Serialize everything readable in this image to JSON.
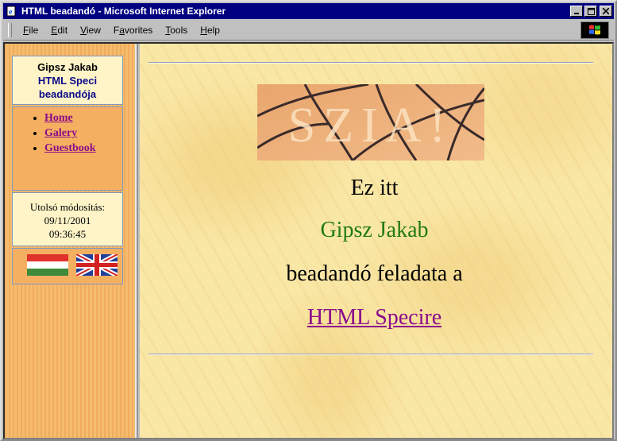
{
  "window": {
    "title": "HTML beadandó - Microsoft Internet Explorer"
  },
  "menu": {
    "items": [
      {
        "label": "File",
        "accel": "F",
        "rest": "ile"
      },
      {
        "label": "Edit",
        "accel": "E",
        "rest": "dit"
      },
      {
        "label": "View",
        "accel": "V",
        "rest": "iew"
      },
      {
        "label": "Favorites",
        "accel": "a",
        "rest_pre": "F",
        "rest": "vorites"
      },
      {
        "label": "Tools",
        "accel": "T",
        "rest": "ools"
      },
      {
        "label": "Help",
        "accel": "H",
        "rest": "elp"
      }
    ]
  },
  "sidebar": {
    "title_line1": "Gipsz Jakab",
    "title_line2": "HTML Speci",
    "title_line3": "beadandója",
    "nav": [
      {
        "label": "Home"
      },
      {
        "label": "Galery"
      },
      {
        "label": "Guestbook"
      }
    ],
    "modified_label": "Utolsó módosítás:",
    "modified_date": "09/11/2001",
    "modified_time": "09:36:45",
    "flags": [
      {
        "name": "hungarian-flag-icon"
      },
      {
        "name": "uk-flag-icon"
      }
    ]
  },
  "main": {
    "banner_text": "SZIA!",
    "line1": "Ez itt",
    "line2": "Gipsz Jakab",
    "line3": "beadandó feladata a",
    "link": "HTML Specire"
  },
  "colors": {
    "titlebar": "#000080",
    "sidebar_bg": "#f5b868",
    "main_bg": "#f9e7a6",
    "link": "#8b0a8b",
    "green_text": "#1f7a10"
  }
}
